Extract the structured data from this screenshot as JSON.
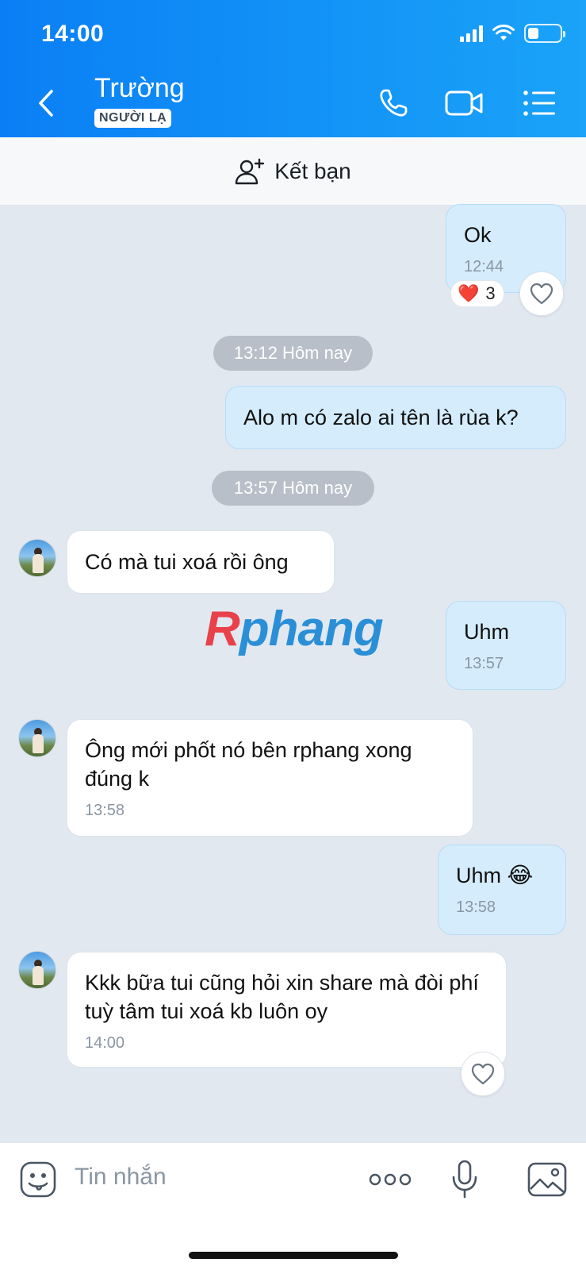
{
  "status_bar": {
    "time": "14:00"
  },
  "header": {
    "contact_name": "Trường",
    "badge": "NGƯỜI LẠ",
    "icons": [
      "back-icon",
      "phone-icon",
      "video-call-icon",
      "menu-list-icon"
    ]
  },
  "add_friend": {
    "label": "Kết bạn",
    "icon": "add-user-icon"
  },
  "messages": [
    {
      "side": "out",
      "text": "Ok",
      "time": "12:44",
      "reaction": {
        "emoji": "❤️",
        "count": "3"
      }
    },
    {
      "type": "divider",
      "text": "13:12 Hôm nay"
    },
    {
      "side": "out",
      "text": "Alo m có zalo ai tên là rùa k?"
    },
    {
      "type": "divider",
      "text": "13:57 Hôm nay"
    },
    {
      "side": "in",
      "text": "Có mà tui xoá rồi ông"
    },
    {
      "side": "out",
      "text": "Uhm",
      "time": "13:57"
    },
    {
      "side": "in",
      "text": "Ông mới phốt nó bên rphang xong đúng k",
      "time": "13:58"
    },
    {
      "side": "out",
      "text": "Uhm",
      "emoji": "😂",
      "time": "13:58"
    },
    {
      "side": "in",
      "text": "Kkk bữa tui cũng hỏi xin share mà đòi phí tuỳ tâm tui xoá kb luôn oy",
      "time": "14:00"
    }
  ],
  "watermark": {
    "r": "R",
    "rest": "phang"
  },
  "input": {
    "placeholder": "Tin nhắn",
    "icons": [
      "sticker-icon",
      "more-icon",
      "microphone-icon",
      "image-icon"
    ]
  },
  "colors": {
    "header_start": "#0a7ff5",
    "header_end": "#1aa3f8",
    "bubble_out": "#d4ecfc",
    "bubble_in": "#ffffff",
    "chat_bg": "#e2e8f0"
  }
}
